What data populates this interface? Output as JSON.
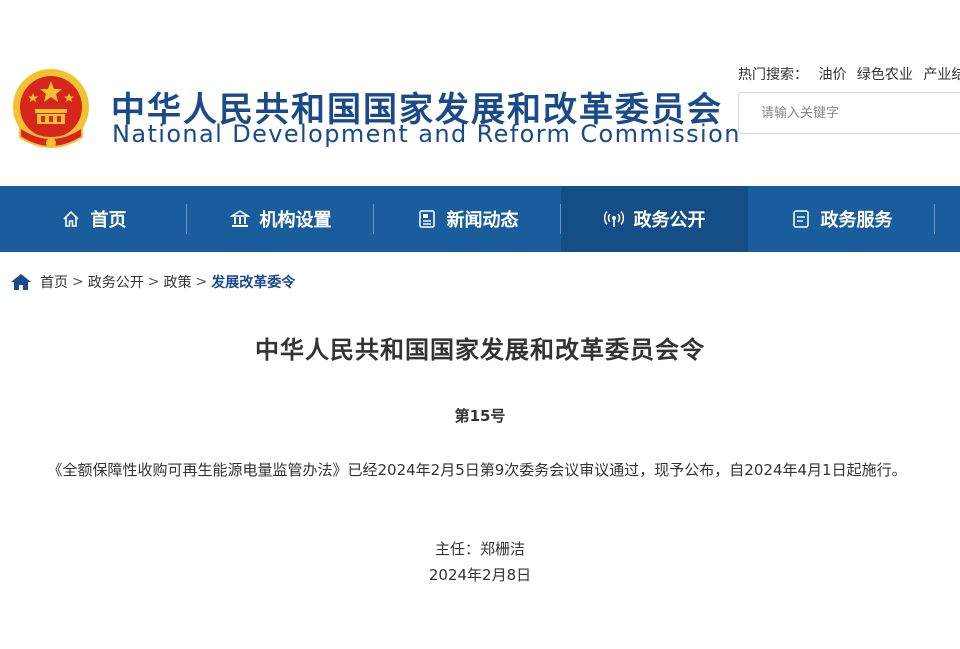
{
  "header": {
    "title_cn": "中华人民共和国国家发展和改革委员会",
    "title_en": "National Development and Reform Commission",
    "hot_search_label": "热门搜索：",
    "hot_search_links": [
      "油价",
      "绿色农业",
      "产业结"
    ],
    "search_placeholder": "请输入关键字"
  },
  "nav": {
    "items": [
      {
        "label": "首页",
        "icon": "home-outline-icon"
      },
      {
        "label": "机构设置",
        "icon": "building-icon"
      },
      {
        "label": "新闻动态",
        "icon": "newspaper-icon"
      },
      {
        "label": "政务公开",
        "icon": "broadcast-icon",
        "active": true
      },
      {
        "label": "政务服务",
        "icon": "document-icon"
      }
    ],
    "active_color": "#154e86",
    "bar_color": "#1a5d9c"
  },
  "breadcrumb": {
    "items": [
      "首页",
      "政务公开",
      "政策"
    ],
    "separator": ">",
    "current": "发展改革委令"
  },
  "article": {
    "title": "中华人民共和国国家发展和改革委员会令",
    "number": "第15号",
    "body": "《全额保障性收购可再生能源电量监管办法》已经2024年2月5日第9次委务会议审议通过，现予公布，自2024年4月1日起施行。",
    "signer": "主任：郑栅洁",
    "date": "2024年2月8日"
  },
  "colors": {
    "brand_blue": "#1a4a8a",
    "emblem_red": "#d7261e",
    "emblem_gold": "#f2c230"
  }
}
